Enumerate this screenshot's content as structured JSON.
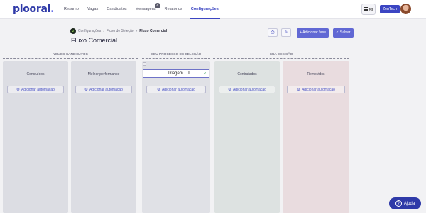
{
  "brand": {
    "logo_text": "plooral"
  },
  "nav": {
    "items": [
      {
        "label": "Resumo"
      },
      {
        "label": "Vagas"
      },
      {
        "label": "Candidatos"
      },
      {
        "label": "Mensagens",
        "badge": "4"
      },
      {
        "label": "Relatórios"
      },
      {
        "label": "Configurações",
        "active": true
      }
    ]
  },
  "top_right": {
    "apps_label": "R$",
    "company": "ZenTech"
  },
  "breadcrumb": {
    "logo": "Z",
    "items": [
      "Configurações",
      "Fluxo de Seleção",
      "Fluxo Comercial"
    ]
  },
  "page": {
    "title": "Fluxo Comercial"
  },
  "actions": {
    "print_icon": "printer-icon",
    "edit_icon": "pencil-icon",
    "add_phase": "+ Adicionar fase",
    "save": "Salvar"
  },
  "sections": {
    "new": "NOVOS CANDIDATOS",
    "process": "SEU PROCESSO DE SELEÇÃO",
    "decision": "SUA DECISÃO"
  },
  "columns": {
    "concluidos": {
      "title": "Concluídos"
    },
    "melhor": {
      "title": "Melhor performance"
    },
    "triagem": {
      "value": "Triagem"
    },
    "contratados": {
      "title": "Contratados"
    },
    "removidos": {
      "title": "Removidos"
    }
  },
  "automation_label": "Adicionar automação",
  "help": {
    "label": "Ajuda"
  },
  "colors": {
    "primary": "#3b45c2",
    "button": "#6168d4",
    "removed_bg": "#e9dcdf",
    "hired_bg": "#dde2e1"
  }
}
